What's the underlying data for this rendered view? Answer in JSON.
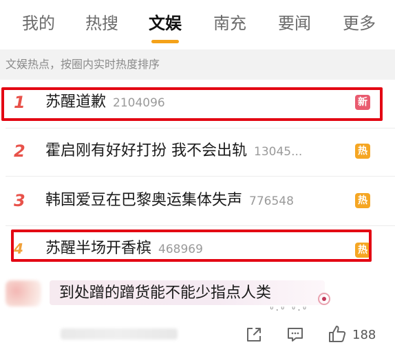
{
  "tabs": [
    {
      "label": "我的"
    },
    {
      "label": "热搜"
    },
    {
      "label": "文娱"
    },
    {
      "label": "南充"
    },
    {
      "label": "要闻"
    },
    {
      "label": "更多"
    }
  ],
  "active_tab": "文娱",
  "subtitle": "文娱热点，按圈内实时热度排序",
  "list": [
    {
      "rank": "1",
      "title": "苏醒道歉",
      "count": "2104096",
      "badge": "新"
    },
    {
      "rank": "2",
      "title": "霍启刚有好好打扮 我不会出轨",
      "count": "13045...",
      "badge": "热"
    },
    {
      "rank": "3",
      "title": "韩国爱豆在巴黎奥运集体失声",
      "count": "776548",
      "badge": "热"
    },
    {
      "rank": "4",
      "title": "苏醒半场开香槟",
      "count": "468969",
      "badge": "热"
    }
  ],
  "comment": {
    "text": "到处蹭的蹭货能不能少指点人类",
    "likes": "188"
  },
  "colors": {
    "accent": "#f4a21a",
    "badge_new": "#e95b6f",
    "badge_hot": "#f5a623",
    "rank_top": "#e8524a",
    "rank_4": "#f0a13a",
    "highlight": "#e30613"
  },
  "icons": {
    "share": "share-icon",
    "comment": "comment-icon",
    "like": "thumbs-up-icon"
  }
}
